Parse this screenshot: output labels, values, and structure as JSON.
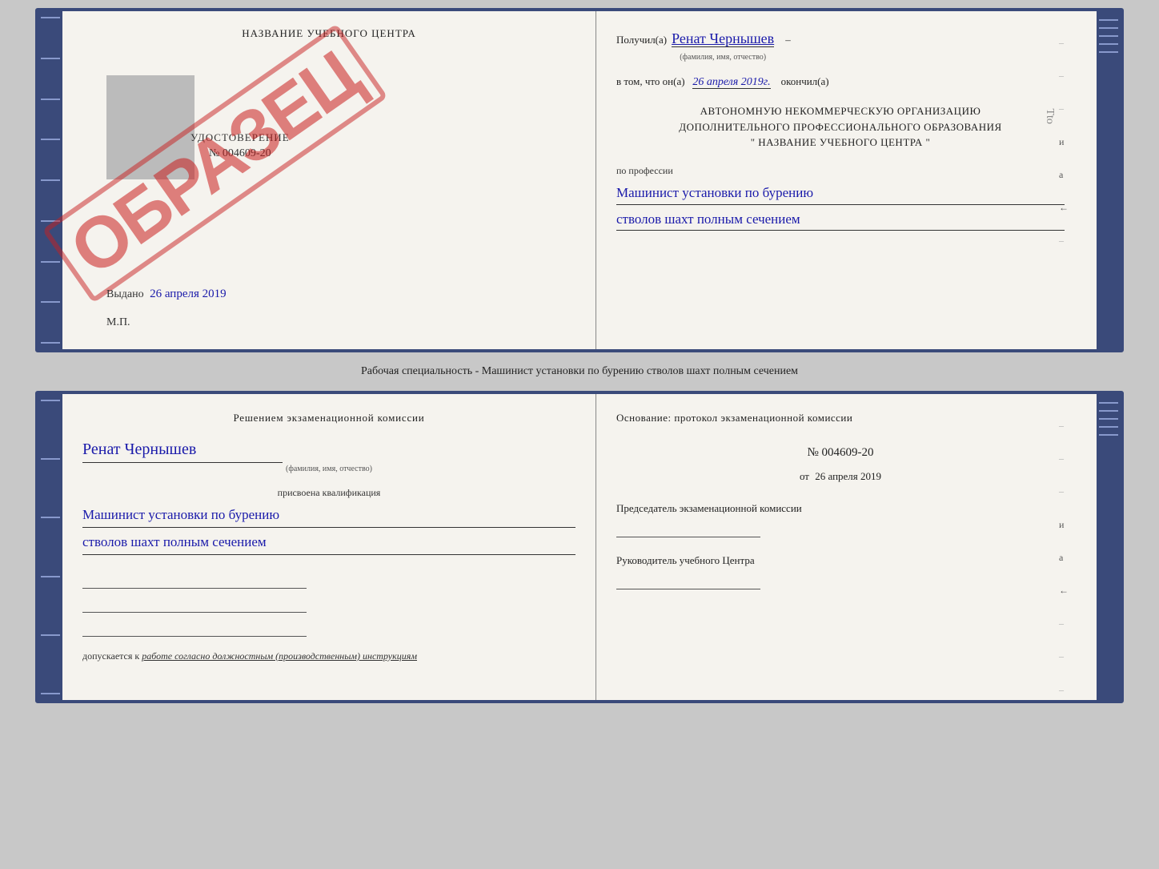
{
  "page": {
    "background": "#c8c8c8"
  },
  "top_document": {
    "left": {
      "school_name": "НАЗВАНИЕ УЧЕБНОГО ЦЕНТРА",
      "udostoverenie_title": "УДОСТОВЕРЕНИЕ",
      "udostoverenie_num": "№ 004609-20",
      "vydano_label": "Выдано",
      "vydano_date": "26 апреля 2019",
      "mp_label": "М.П.",
      "obrazets": "ОБРАЗЕЦ"
    },
    "right": {
      "poluchil_label": "Получил(а)",
      "recipient_name": "Ренат Чернышев",
      "fio_subtext": "(фамилия, имя, отчество)",
      "dash": "–",
      "vtom_label": "в том, что он(а)",
      "completion_date": "26 апреля 2019г.",
      "okonchil_label": "окончил(а)",
      "org_line1": "АВТОНОМНУЮ НЕКОММЕРЧЕСКУЮ ОРГАНИЗАЦИЮ",
      "org_line2": "ДОПОЛНИТЕЛЬНОГО ПРОФЕССИОНАЛЬНОГО ОБРАЗОВАНИЯ",
      "org_line3": "\" НАЗВАНИЕ УЧЕБНОГО ЦЕНТРА \"",
      "profession_label": "по профессии",
      "profession_line1": "Машинист установки по бурению",
      "profession_line2": "стволов шахт полным сечением"
    }
  },
  "separator": {
    "text": "Рабочая специальность - Машинист установки по бурению стволов шахт полным сечением"
  },
  "bottom_document": {
    "left": {
      "resheniyem_title": "Решением экзаменационной комиссии",
      "person_name": "Ренат Чернышев",
      "fio_subtext": "(фамилия, имя, отчество)",
      "prisvoena_label": "присвоена квалификация",
      "qualification_line1": "Машинист установки по бурению",
      "qualification_line2": "стволов шахт полным сечением",
      "dopuskaetsya_label": "допускается к",
      "dopuskaetsya_text": "работе согласно должностным (производственным) инструкциям"
    },
    "right": {
      "osnovanie_label": "Основание: протокол экзаменационной комиссии",
      "protocol_num": "№ 004609-20",
      "protocol_date_prefix": "от",
      "protocol_date": "26 апреля 2019",
      "predsedatel_label": "Председатель экзаменационной комиссии",
      "rukovoditel_label": "Руководитель учебного Центра"
    }
  },
  "edge_marks": {
    "items": [
      "–",
      "–",
      "–",
      "и",
      "а",
      "←",
      "–",
      "–",
      "–"
    ]
  },
  "edge_marks_bottom": {
    "items": [
      "–",
      "–",
      "–",
      "и",
      "а",
      "←",
      "–",
      "–",
      "–"
    ]
  }
}
